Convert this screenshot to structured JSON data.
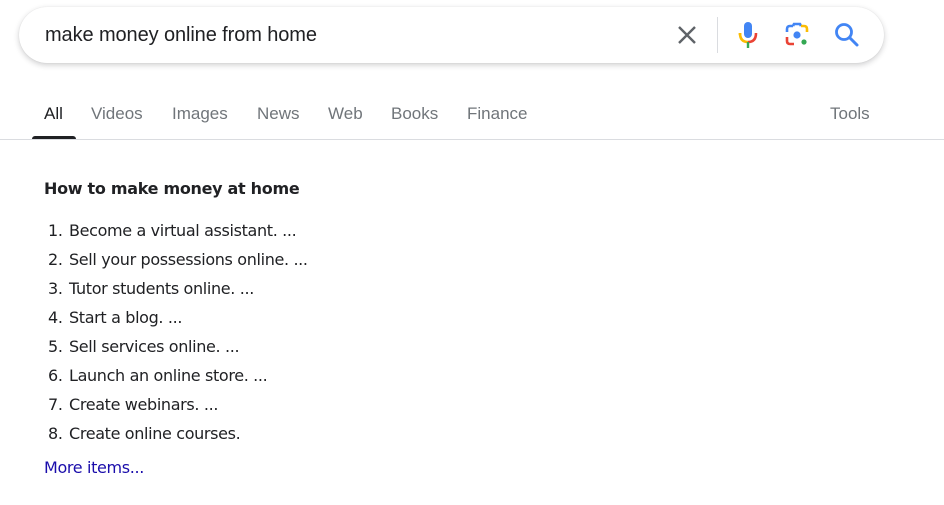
{
  "search": {
    "query": "make money online from home",
    "icons": {
      "clear": "close-icon",
      "voice": "microphone-icon",
      "lens": "camera-lens-icon",
      "submit": "search-icon"
    }
  },
  "tabs": {
    "items": [
      {
        "label": "All",
        "active": true
      },
      {
        "label": "Videos",
        "active": false
      },
      {
        "label": "Images",
        "active": false
      },
      {
        "label": "News",
        "active": false
      },
      {
        "label": "Web",
        "active": false
      },
      {
        "label": "Books",
        "active": false
      },
      {
        "label": "Finance",
        "active": false
      }
    ],
    "tools_label": "Tools"
  },
  "snippet": {
    "title": "How to make money at home",
    "items": [
      {
        "num": "1.",
        "text": "Become a virtual assistant. ..."
      },
      {
        "num": "2.",
        "text": "Sell your possessions online. ..."
      },
      {
        "num": "3.",
        "text": "Tutor students online. ..."
      },
      {
        "num": "4.",
        "text": "Start a blog. ..."
      },
      {
        "num": "5.",
        "text": "Sell services online. ..."
      },
      {
        "num": "6.",
        "text": "Launch an online store. ..."
      },
      {
        "num": "7.",
        "text": "Create webinars. ..."
      },
      {
        "num": "8.",
        "text": "Create online courses."
      }
    ],
    "more_label": "More items..."
  },
  "colors": {
    "link": "#1a0dab",
    "tab_inactive": "#70757a",
    "text": "#202124",
    "google_blue": "#4285f4",
    "google_red": "#ea4335",
    "google_yellow": "#fbbc04",
    "google_green": "#34a853"
  }
}
